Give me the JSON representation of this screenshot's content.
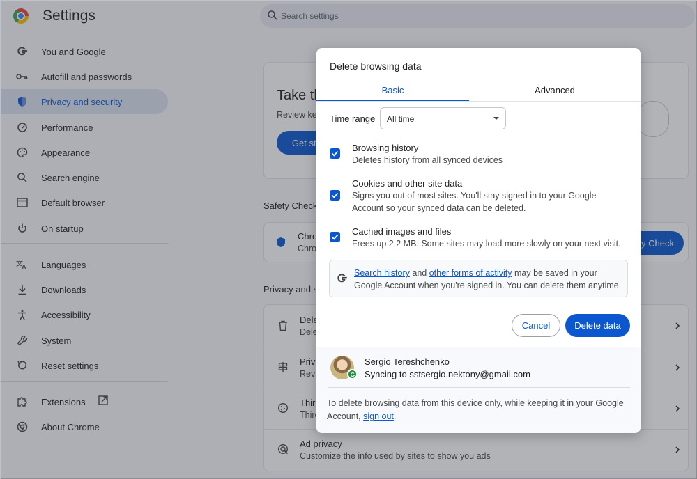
{
  "header": {
    "title": "Settings",
    "search_placeholder": "Search settings"
  },
  "sidebar": {
    "items": [
      {
        "label": "You and Google",
        "icon": "google-g-icon",
        "active": false
      },
      {
        "label": "Autofill and passwords",
        "icon": "key-icon",
        "active": false
      },
      {
        "label": "Privacy and security",
        "icon": "shield-icon",
        "active": true
      },
      {
        "label": "Performance",
        "icon": "speedometer-icon",
        "active": false
      },
      {
        "label": "Appearance",
        "icon": "palette-icon",
        "active": false
      },
      {
        "label": "Search engine",
        "icon": "search-icon",
        "active": false
      },
      {
        "label": "Default browser",
        "icon": "browser-window-icon",
        "active": false
      },
      {
        "label": "On startup",
        "icon": "power-icon",
        "active": false
      },
      {
        "label": "Languages",
        "icon": "translate-icon",
        "active": false
      },
      {
        "label": "Downloads",
        "icon": "download-icon",
        "active": false
      },
      {
        "label": "Accessibility",
        "icon": "accessibility-icon",
        "active": false
      },
      {
        "label": "System",
        "icon": "wrench-icon",
        "active": false
      },
      {
        "label": "Reset settings",
        "icon": "reset-icon",
        "active": false
      },
      {
        "label": "Extensions",
        "icon": "puzzle-icon",
        "active": false
      },
      {
        "label": "About Chrome",
        "icon": "chrome-icon",
        "active": false
      }
    ]
  },
  "background": {
    "card_title": "Take th",
    "card_desc": "Review key",
    "card_button": "Get star",
    "safety_check_heading": "Safety Check",
    "safety_row_title": "Chron",
    "safety_row_desc": "Chron",
    "safety_button": "ty Check",
    "privacy_heading": "Privacy and s",
    "rows": [
      {
        "title": "Dele",
        "desc": "Dele",
        "icon": "trash-icon"
      },
      {
        "title": "Priva",
        "desc": "Revie",
        "icon": "privacy-guide-icon"
      },
      {
        "title": "Thirc",
        "desc": "Thirc",
        "icon": "cookie-icon"
      },
      {
        "title": "Ad privacy",
        "desc": "Customize the info used by sites to show you ads",
        "icon": "ad-privacy-icon"
      }
    ]
  },
  "dialog": {
    "title": "Delete browsing data",
    "tabs": [
      {
        "label": "Basic",
        "selected": true
      },
      {
        "label": "Advanced",
        "selected": false
      }
    ],
    "time_range_label": "Time range",
    "time_range_value": "All time",
    "options": [
      {
        "title": "Browsing history",
        "desc": "Deletes history from all synced devices",
        "checked": true
      },
      {
        "title": "Cookies and other site data",
        "desc": "Signs you out of most sites. You'll stay signed in to your Google Account so your synced data can be deleted.",
        "checked": true
      },
      {
        "title": "Cached images and files",
        "desc": "Frees up 2.2 MB. Some sites may load more slowly on your next visit.",
        "checked": true
      }
    ],
    "info": {
      "link1": "Search history",
      "and": " and ",
      "link2": "other forms of activity",
      "rest": " may be saved in your Google Account when you're signed in. You can delete them anytime."
    },
    "cancel_label": "Cancel",
    "delete_label": "Delete data",
    "account": {
      "name": "Sergio Tereshchenko",
      "sync_text": "Syncing to sstsergio.nektony@gmail.com"
    },
    "footer_note": "To delete browsing data from this device only, while keeping it in your Google Account, ",
    "footer_link": "sign out",
    "footer_end": "."
  },
  "colors": {
    "accent": "#0b57d0",
    "sync_green": "#1e8e3e",
    "active_nav_bg": "#dde3f0"
  }
}
